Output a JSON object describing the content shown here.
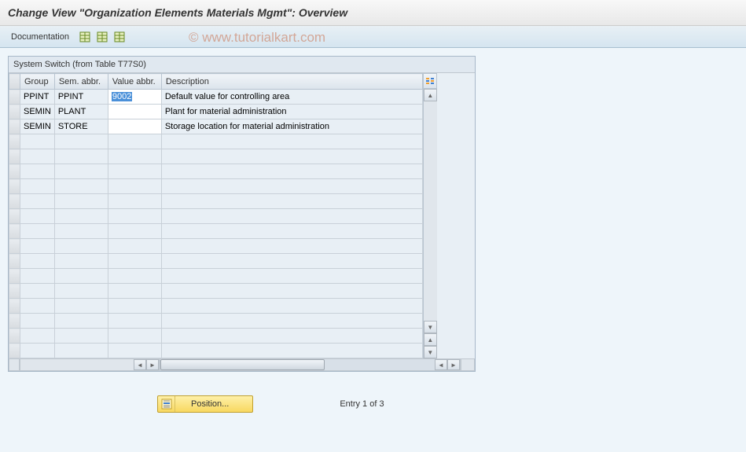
{
  "title": "Change View \"Organization Elements Materials Mgmt\": Overview",
  "toolbar": {
    "documentation": "Documentation"
  },
  "watermark": "© www.tutorialkart.com",
  "grid": {
    "title": "System Switch (from Table T77S0)",
    "headers": {
      "group": "Group",
      "sem": "Sem. abbr.",
      "value": "Value abbr.",
      "desc": "Description"
    },
    "rows": [
      {
        "group": "PPINT",
        "sem": "PPINT",
        "value": "9002",
        "desc": "Default value for controlling area",
        "selected": true
      },
      {
        "group": "SEMIN",
        "sem": "PLANT",
        "value": "",
        "desc": "Plant for material administration",
        "selected": false
      },
      {
        "group": "SEMIN",
        "sem": "STORE",
        "value": "",
        "desc": "Storage location for material administration",
        "selected": false
      }
    ]
  },
  "footer": {
    "position": "Position...",
    "entry": "Entry 1 of 3"
  }
}
